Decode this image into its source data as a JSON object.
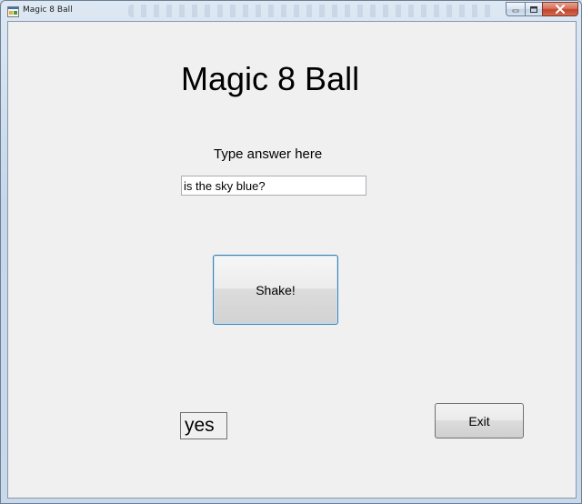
{
  "window": {
    "title": "Magic 8 Ball",
    "icon": "app-icon"
  },
  "form": {
    "heading": "Magic 8 Ball",
    "prompt_label": "Type answer here",
    "question_value": "is the sky blue?",
    "shake_label": "Shake!",
    "answer_text": "yes",
    "exit_label": "Exit"
  },
  "colors": {
    "client_background": "#f0f0f0",
    "focus_border": "#3c7fb1",
    "close_button": "#c3442a"
  }
}
